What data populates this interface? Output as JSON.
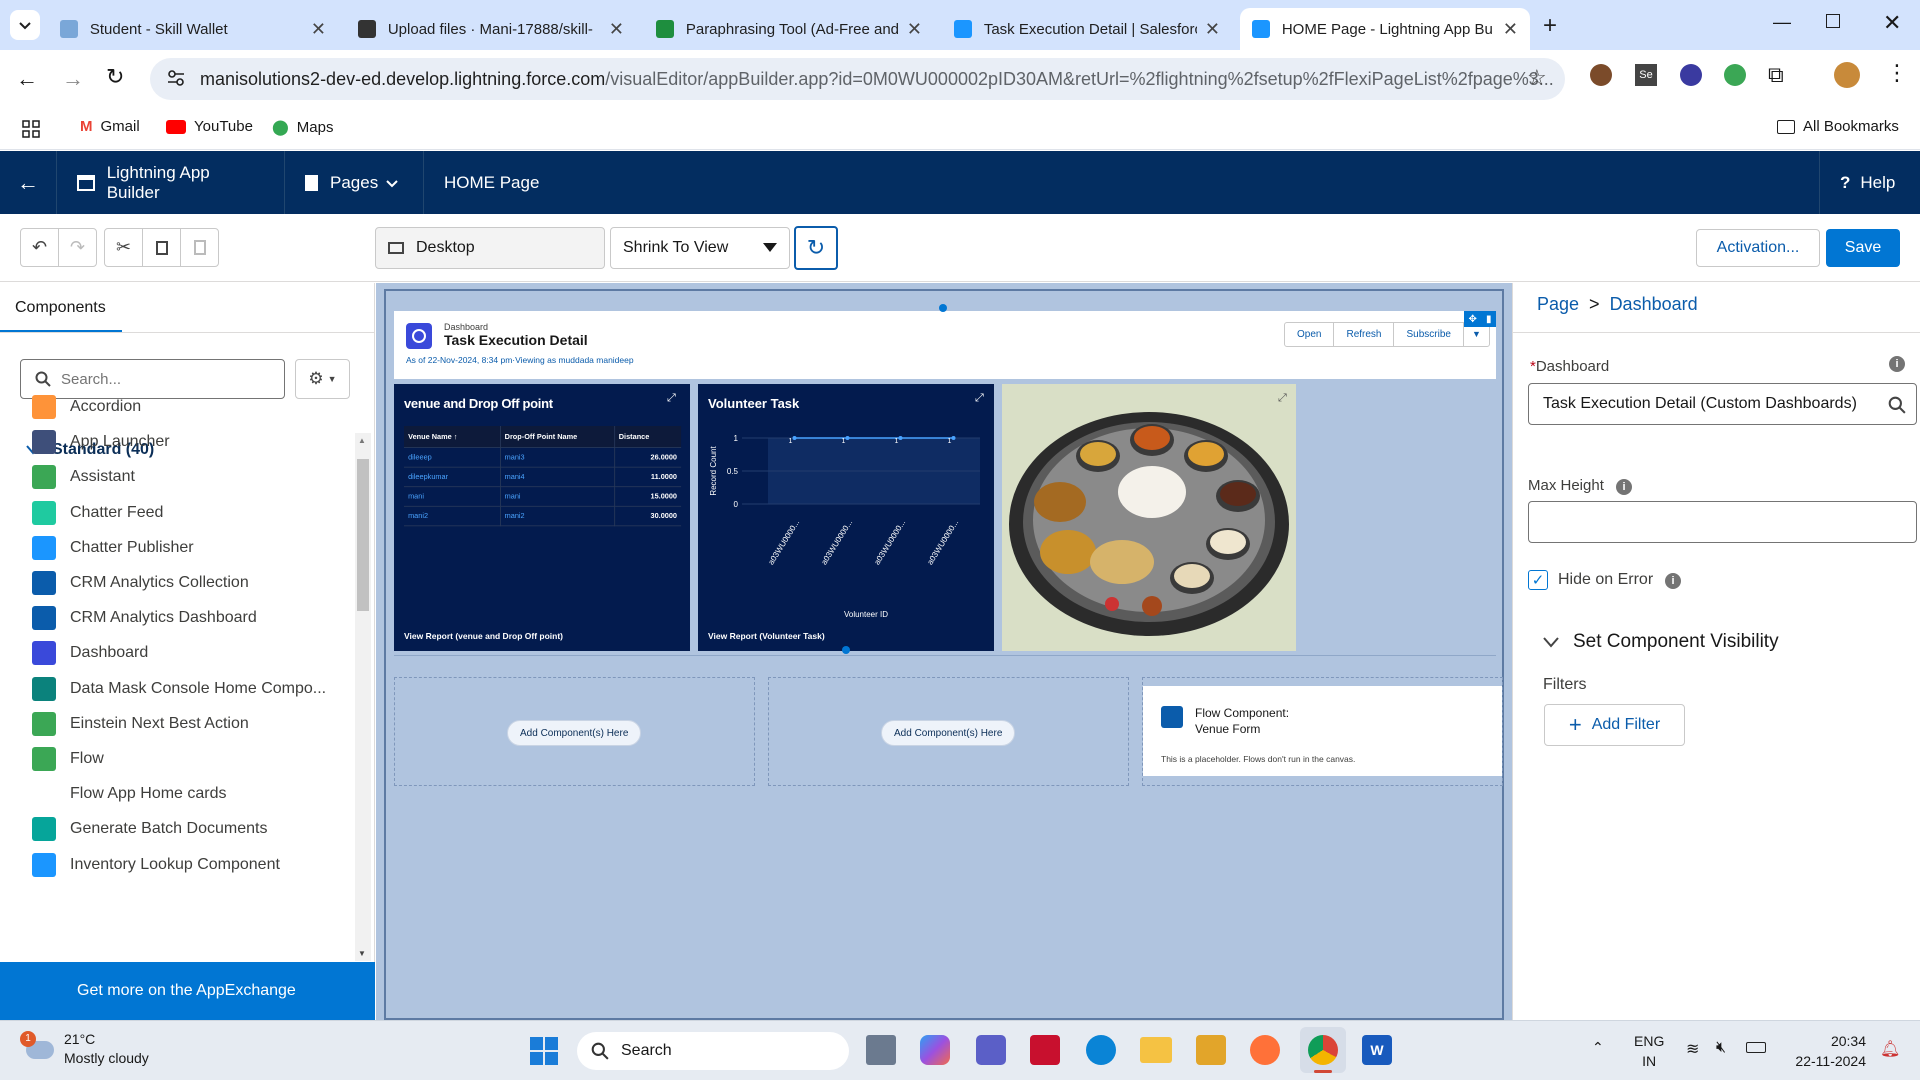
{
  "browser": {
    "tabs": [
      {
        "title": "Student - Skill Wallet",
        "color": "#7aa7d8"
      },
      {
        "title": "Upload files · Mani-17888/skill-",
        "color": "#333"
      },
      {
        "title": "Paraphrasing Tool (Ad-Free and",
        "color": "#1e8e3e"
      },
      {
        "title": "Task Execution Detail | Salesforc",
        "color": "#1b96ff"
      },
      {
        "title": "HOME Page - Lightning App Bu",
        "color": "#1b96ff"
      }
    ],
    "url_host": "manisolutions2-dev-ed.develop.lightning.force.com",
    "url_path": "/visualEditor/appBuilder.app?id=0M0WU000002pID30AM&retUrl=%2flightning%2fsetup%2fFlexiPageList%2fpage%3...",
    "bookmarks": [
      "Gmail",
      "YouTube",
      "Maps"
    ],
    "all_bookmarks": "All Bookmarks"
  },
  "header": {
    "app_name": "Lightning App Builder",
    "pages": "Pages",
    "page_name": "HOME Page",
    "help": "Help"
  },
  "toolbar": {
    "device": "Desktop",
    "zoom": "Shrink To View",
    "activation": "Activation...",
    "save": "Save"
  },
  "left": {
    "tab": "Components",
    "search_placeholder": "Search...",
    "section": "Standard (40)",
    "components": [
      {
        "label": "Accordion",
        "icon": "accordion-icon",
        "color": "#fe9339"
      },
      {
        "label": "App Launcher",
        "icon": "app-launcher-icon",
        "color": "#3e4f7a"
      },
      {
        "label": "Assistant",
        "icon": "assistant-icon",
        "color": "#3ba755"
      },
      {
        "label": "Chatter Feed",
        "icon": "chatter-feed-icon",
        "color": "#1fcaa0"
      },
      {
        "label": "Chatter Publisher",
        "icon": "chatter-publisher-icon",
        "color": "#1b96ff"
      },
      {
        "label": "CRM Analytics Collection",
        "icon": "analytics-icon",
        "color": "#0b5cab"
      },
      {
        "label": "CRM Analytics Dashboard",
        "icon": "analytics-icon",
        "color": "#0b5cab"
      },
      {
        "label": "Dashboard",
        "icon": "dashboard-icon",
        "color": "#3a49da"
      },
      {
        "label": "Data Mask Console Home Compo...",
        "icon": "data-mask-icon",
        "color": "#0b827c"
      },
      {
        "label": "Einstein Next Best Action",
        "icon": "einstein-icon",
        "color": "#3ba755"
      },
      {
        "label": "Flow",
        "icon": "flow-icon",
        "color": "#3ba755"
      },
      {
        "label": "Flow App Home cards",
        "icon": "",
        "color": ""
      },
      {
        "label": "Generate Batch Documents",
        "icon": "batch-docs-icon",
        "color": "#06a59a"
      },
      {
        "label": "Inventory Lookup Component",
        "icon": "inventory-icon",
        "color": "#1b96ff"
      }
    ],
    "appexchange": "Get more on the AppExchange"
  },
  "canvas": {
    "dash": {
      "label": "Dashboard",
      "title": "Task Execution Detail",
      "asof": "As of 22-Nov-2024, 8:34 pm·Viewing as muddada manideep",
      "buttons": [
        "Open",
        "Refresh",
        "Subscribe"
      ]
    },
    "table_widget": {
      "title": "venue and Drop Off point",
      "columns": [
        "Venue Name ↑",
        "Drop-Off Point Name",
        "Distance"
      ],
      "rows": [
        [
          "dileeep",
          "mani3",
          "26.0000"
        ],
        [
          "dileepkumar",
          "mani4",
          "11.0000"
        ],
        [
          "mani",
          "mani",
          "15.0000"
        ],
        [
          "mani2",
          "mani2",
          "30.0000"
        ]
      ],
      "footer": "View Report (venue and Drop Off point)"
    },
    "chart_widget": {
      "title": "Volunteer Task",
      "footer": "View Report (Volunteer Task)"
    },
    "placeholders": [
      "Add Component(s) Here",
      "Add Component(s) Here"
    ],
    "flow": {
      "title": "Flow Component:",
      "name": "Venue Form",
      "note": "This is a placeholder. Flows don't run in the canvas."
    }
  },
  "chart_data": {
    "type": "line",
    "categories": [
      "a03WU0000...",
      "a03WU0000...",
      "a03WU0000...",
      "a03WU0000..."
    ],
    "values": [
      1,
      1,
      1,
      1
    ],
    "point_labels": [
      "1",
      "1",
      "1",
      "1"
    ],
    "ylabel": "Record Count",
    "xlabel": "Volunteer ID",
    "yticks": [
      "0",
      "0.5",
      "1"
    ],
    "ylim": [
      0,
      1
    ]
  },
  "right": {
    "breadcrumb_page": "Page",
    "breadcrumb_sep": ">",
    "breadcrumb_current": "Dashboard",
    "dashboard_label": "Dashboard",
    "dashboard_value": "Task Execution Detail (Custom Dashboards)",
    "max_height_label": "Max Height",
    "hide_on_error": "Hide on Error",
    "visibility": "Set Component Visibility",
    "filters": "Filters",
    "add_filter": "Add Filter"
  },
  "taskbar": {
    "weather_temp": "21°C",
    "weather_desc": "Mostly cloudy",
    "weather_badge": "1",
    "search": "Search",
    "lang1": "ENG",
    "lang2": "IN",
    "time": "20:34",
    "date": "22-11-2024"
  }
}
